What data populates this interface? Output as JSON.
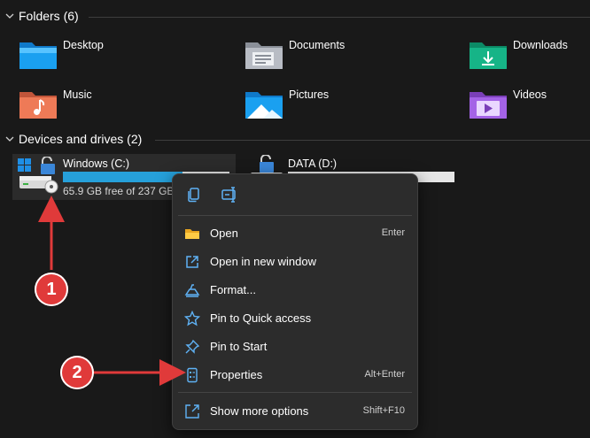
{
  "folders_section": {
    "title": "Folders (6)",
    "items": [
      {
        "label": "Desktop",
        "icon": "desktop-folder-icon"
      },
      {
        "label": "Documents",
        "icon": "documents-folder-icon"
      },
      {
        "label": "Downloads",
        "icon": "downloads-folder-icon"
      },
      {
        "label": "Music",
        "icon": "music-folder-icon"
      },
      {
        "label": "Pictures",
        "icon": "pictures-folder-icon"
      },
      {
        "label": "Videos",
        "icon": "videos-folder-icon"
      }
    ]
  },
  "drives_section": {
    "title": "Devices and drives (2)",
    "drives": [
      {
        "name": "Windows (C:)",
        "free_text": "65.9 GB free of 237 GB",
        "used_fraction": 0.72,
        "icon": "windows-drive-icon"
      },
      {
        "name": "DATA (D:)",
        "icon": "data-drive-icon"
      }
    ]
  },
  "context_menu": {
    "top_icons": [
      "copy-icon",
      "rename-icon"
    ],
    "items": [
      {
        "label": "Open",
        "shortcut": "Enter",
        "icon": "open-folder-icon"
      },
      {
        "label": "Open in new window",
        "shortcut": "",
        "icon": "open-new-window-icon"
      },
      {
        "label": "Format...",
        "shortcut": "",
        "icon": "format-icon"
      },
      {
        "label": "Pin to Quick access",
        "shortcut": "",
        "icon": "star-icon"
      },
      {
        "label": "Pin to Start",
        "shortcut": "",
        "icon": "pin-icon"
      },
      {
        "label": "Properties",
        "shortcut": "Alt+Enter",
        "icon": "properties-icon"
      },
      {
        "label": "Show more options",
        "shortcut": "Shift+F10",
        "icon": "show-more-icon"
      }
    ]
  },
  "annotations": {
    "step1": "1",
    "step2": "2",
    "arrow_color": "#e03a3a"
  },
  "colors": {
    "background": "#191919",
    "accent": "#26a0da",
    "menu_bg": "#2c2c2c"
  }
}
